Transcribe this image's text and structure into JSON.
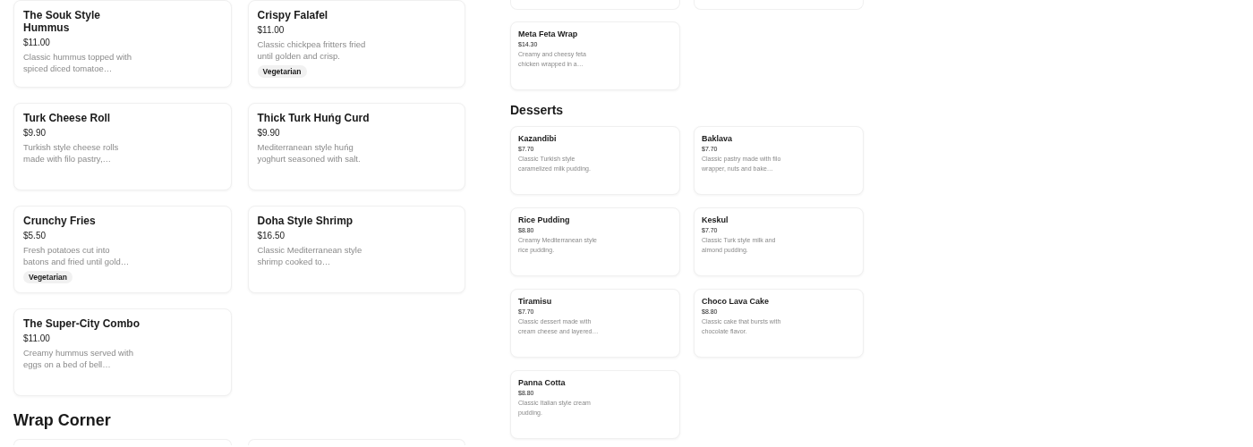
{
  "panels": [
    {
      "kind": "large",
      "sections": [
        {
          "items": [
            {
              "name": "The Souk Style Hummus",
              "price": "$11.00",
              "description": "Classic hummus topped with spiced diced tomatoe…"
            },
            {
              "name": "Crispy Falafel",
              "price": "$11.00",
              "description": "Classic chickpea fritters fried until golden and crisp.",
              "tags": [
                "Vegetarian"
              ]
            },
            {
              "name": "Turk Cheese Roll",
              "price": "$9.90",
              "description": "Turkish style cheese rolls made with filo pastry,…"
            },
            {
              "name": "Thick Turk Huńg Curd",
              "price": "$9.90",
              "description": "Mediterranean style huńg yoghurt seasoned with salt."
            },
            {
              "name": "Crunchy Fries",
              "price": "$5.50",
              "description": "Fresh potatoes cut into batons and fried until gold…",
              "tags": [
                "Vegetarian"
              ]
            },
            {
              "name": "Doha Style Shrimp",
              "price": "$16.50",
              "description": "Classic Mediterranean style shrimp cooked to…"
            },
            {
              "name": "The Super-City Combo",
              "price": "$11.00",
              "description": "Creamy hummus served with eggs on a bed of bell…"
            }
          ]
        },
        {
          "title": "Wrap Corner"
        }
      ]
    },
    {
      "kind": "small",
      "sections": [
        {
          "items": [
            {
              "name": "Meta Feta Wrap",
              "price": "$14.30",
              "description": "Creamy and cheesy feta chicken wrapped in a…"
            }
          ]
        },
        {
          "title": "Desserts",
          "items": [
            {
              "name": "Kazandibi",
              "price": "$7.70",
              "description": "Classic Turkish style caramelized milk pudding."
            },
            {
              "name": "Baklava",
              "price": "$7.70",
              "description": "Classic pastry made with filo wrapper, nuts and bake…"
            },
            {
              "name": "Rice Pudding",
              "price": "$8.80",
              "description": "Creamy Mediterranean style rice pudding."
            },
            {
              "name": "Keskul",
              "price": "$7.70",
              "description": "Classic Turk style milk and almond pudding."
            },
            {
              "name": "Tiramisu",
              "price": "$7.70",
              "description": "Classic dessert made with cream cheese and layered…"
            },
            {
              "name": "Choco Lava Cake",
              "price": "$8.80",
              "description": "Classic cake that bursts with chocolate flavor."
            },
            {
              "name": "Panna Cotta",
              "price": "$8.80",
              "description": "Classic Italian style cream pudding."
            }
          ]
        }
      ]
    }
  ]
}
